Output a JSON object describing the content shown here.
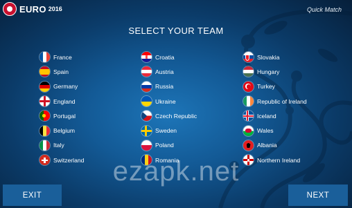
{
  "header": {
    "logo_text": "EURO",
    "logo_year": "2016",
    "mode": "Quick Match"
  },
  "title": "SELECT YOUR TEAM",
  "columns": [
    [
      {
        "name": "France",
        "flag": "france"
      },
      {
        "name": "Spain",
        "flag": "spain"
      },
      {
        "name": "Germany",
        "flag": "germany"
      },
      {
        "name": "England",
        "flag": "england"
      },
      {
        "name": "Portugal",
        "flag": "portugal"
      },
      {
        "name": "Belgium",
        "flag": "belgium"
      },
      {
        "name": "Italy",
        "flag": "italy"
      },
      {
        "name": "Switzerland",
        "flag": "switzerland"
      }
    ],
    [
      {
        "name": "Croatia",
        "flag": "croatia"
      },
      {
        "name": "Austria",
        "flag": "austria"
      },
      {
        "name": "Russia",
        "flag": "russia"
      },
      {
        "name": "Ukraine",
        "flag": "ukraine"
      },
      {
        "name": "Czech Republic",
        "flag": "czech-republic"
      },
      {
        "name": "Sweden",
        "flag": "sweden"
      },
      {
        "name": "Poland",
        "flag": "poland"
      },
      {
        "name": "Romania",
        "flag": "romania"
      }
    ],
    [
      {
        "name": "Slovakia",
        "flag": "slovakia"
      },
      {
        "name": "Hungary",
        "flag": "hungary"
      },
      {
        "name": "Turkey",
        "flag": "turkey"
      },
      {
        "name": "Republic of Ireland",
        "flag": "ireland"
      },
      {
        "name": "Iceland",
        "flag": "iceland"
      },
      {
        "name": "Wales",
        "flag": "wales"
      },
      {
        "name": "Albania",
        "flag": "albania"
      },
      {
        "name": "Northern Ireland",
        "flag": "northern-ireland"
      }
    ]
  ],
  "watermark": "ezapk.net",
  "buttons": {
    "exit": "EXIT",
    "next": "NEXT"
  }
}
